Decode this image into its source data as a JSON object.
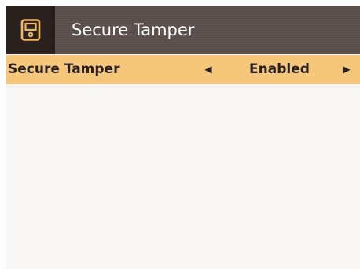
{
  "header": {
    "title": "Secure Tamper",
    "icon": "device-icon"
  },
  "setting": {
    "label": "Secure Tamper",
    "value": "Enabled",
    "prev_icon": "arrow-left-icon",
    "next_icon": "arrow-right-icon"
  },
  "colors": {
    "header_bg": "#5e5250",
    "icon_bg": "#2a211f",
    "accent": "#f6c67a",
    "icon_accent": "#f2b560",
    "body_bg": "#f7f6f4"
  }
}
